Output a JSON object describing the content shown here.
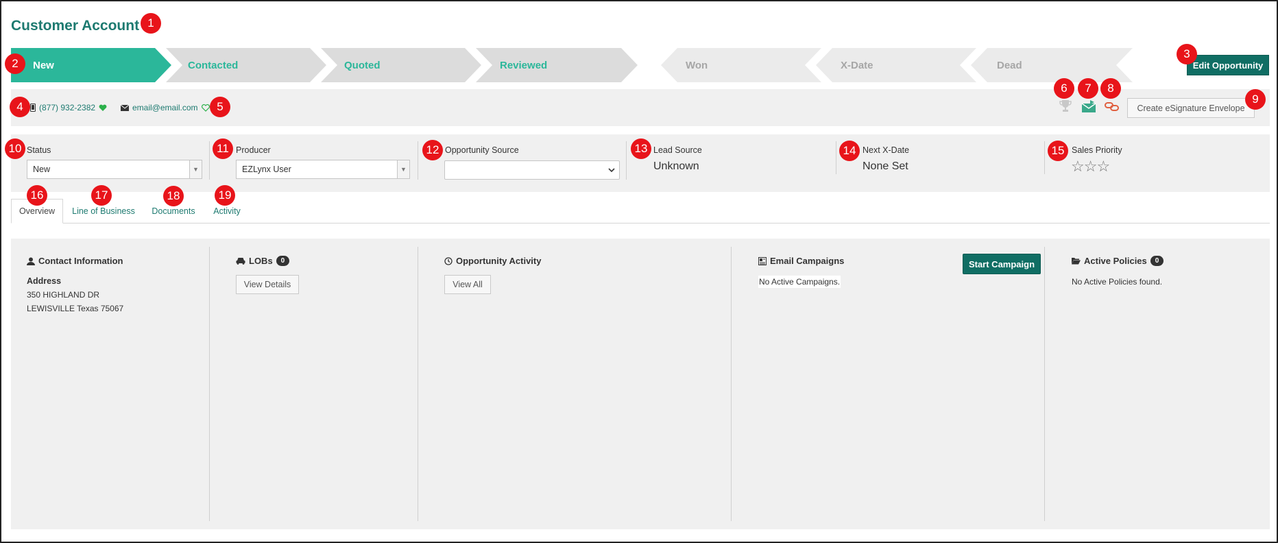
{
  "header": {
    "title": "Customer Account",
    "edit_button": "Edit Opportunity"
  },
  "stages": [
    {
      "label": "New",
      "state": "active"
    },
    {
      "label": "Contacted",
      "state": "pending"
    },
    {
      "label": "Quoted",
      "state": "pending"
    },
    {
      "label": "Reviewed",
      "state": "pending"
    },
    {
      "label": "Won",
      "state": "closed"
    },
    {
      "label": "X-Date",
      "state": "closed"
    },
    {
      "label": "Dead",
      "state": "closed"
    }
  ],
  "contact": {
    "phone": "(877) 932-2382",
    "email": "email@email.com",
    "esignature_button": "Create eSignature Envelope"
  },
  "fields": {
    "status": {
      "label": "Status",
      "value": "New"
    },
    "producer": {
      "label": "Producer",
      "value": "EZLynx User"
    },
    "opportunity_source": {
      "label": "Opportunity Source",
      "value": ""
    },
    "lead_source": {
      "label": "Lead Source",
      "value": "Unknown"
    },
    "next_xdate": {
      "label": "Next X-Date",
      "value": "None Set"
    },
    "sales_priority": {
      "label": "Sales Priority",
      "stars": "☆☆☆",
      "rating": 0
    }
  },
  "tabs": [
    "Overview",
    "Line of Business",
    "Documents",
    "Activity"
  ],
  "panels": {
    "contact_info": {
      "title": "Contact Information",
      "address_label": "Address",
      "address_line1": "350 HIGHLAND DR",
      "address_line2": "LEWISVILLE Texas 75067"
    },
    "lobs": {
      "title": "LOBs",
      "count": "0",
      "button": "View Details"
    },
    "activity": {
      "title": "Opportunity Activity",
      "button": "View All"
    },
    "email_campaigns": {
      "title": "Email Campaigns",
      "empty": "No Active Campaigns.",
      "button": "Start Campaign"
    },
    "policies": {
      "title": "Active Policies",
      "count": "0",
      "empty": "No Active Policies found."
    }
  },
  "markers": [
    "1",
    "2",
    "3",
    "4",
    "5",
    "6",
    "7",
    "8",
    "9",
    "10",
    "11",
    "12",
    "13",
    "14",
    "15",
    "16",
    "17",
    "18",
    "19"
  ],
  "colors": {
    "brand": "#1d7a70",
    "stage_active": "#2bb79a",
    "stage_pending": "#dcdcdc",
    "stage_closed": "#ebebeb",
    "marker": "#e8141a"
  }
}
